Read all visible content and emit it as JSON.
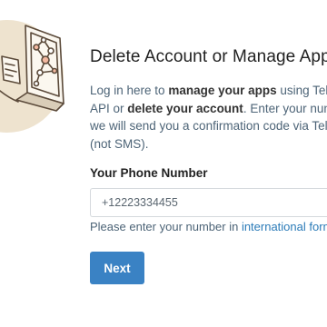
{
  "header": {
    "title": "Delete Account or Manage Apps"
  },
  "intro": {
    "line1_prefix": "Log in here to ",
    "line1_bold": "manage your apps",
    "line1_suffix": " using Telegram",
    "line2_prefix": "API or ",
    "line2_bold": "delete your account",
    "line2_suffix": ". Enter your number and",
    "line3": "we will send you a confirmation code via Telegram",
    "line4": "(not SMS)."
  },
  "form": {
    "phone_label": "Your Phone Number",
    "phone_placeholder": "+12223334455",
    "hint_prefix": "Please enter your number in ",
    "hint_link": "international format",
    "next_label": "Next"
  },
  "icons": {
    "illustration": "laptop-network-illustration-icon"
  }
}
